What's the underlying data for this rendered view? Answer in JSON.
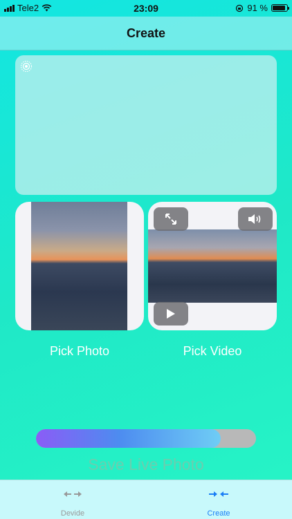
{
  "status_bar": {
    "carrier": "Tele2",
    "time": "23:09",
    "battery": "91 %"
  },
  "nav": {
    "title": "Create"
  },
  "media": {
    "photo_label": "Pick Photo",
    "video_label": "Pick Video"
  },
  "progress": {
    "fraction": 0.84
  },
  "save_button": {
    "label": "Save Live Photo"
  },
  "tabs": [
    {
      "label": "Devide",
      "icon": "arrows-apart-icon",
      "selected": false
    },
    {
      "label": "Create",
      "icon": "arrows-together-icon",
      "selected": true
    }
  ],
  "colors": {
    "accent": "#1a7ef5",
    "tab_inactive": "#999999"
  }
}
